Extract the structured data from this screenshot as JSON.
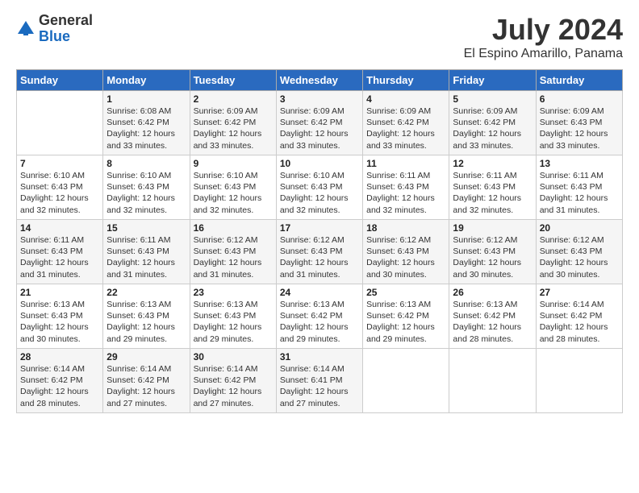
{
  "header": {
    "logo_general": "General",
    "logo_blue": "Blue",
    "month_year": "July 2024",
    "location": "El Espino Amarillo, Panama"
  },
  "days_of_week": [
    "Sunday",
    "Monday",
    "Tuesday",
    "Wednesday",
    "Thursday",
    "Friday",
    "Saturday"
  ],
  "weeks": [
    [
      {
        "day": "",
        "info": ""
      },
      {
        "day": "1",
        "info": "Sunrise: 6:08 AM\nSunset: 6:42 PM\nDaylight: 12 hours\nand 33 minutes."
      },
      {
        "day": "2",
        "info": "Sunrise: 6:09 AM\nSunset: 6:42 PM\nDaylight: 12 hours\nand 33 minutes."
      },
      {
        "day": "3",
        "info": "Sunrise: 6:09 AM\nSunset: 6:42 PM\nDaylight: 12 hours\nand 33 minutes."
      },
      {
        "day": "4",
        "info": "Sunrise: 6:09 AM\nSunset: 6:42 PM\nDaylight: 12 hours\nand 33 minutes."
      },
      {
        "day": "5",
        "info": "Sunrise: 6:09 AM\nSunset: 6:42 PM\nDaylight: 12 hours\nand 33 minutes."
      },
      {
        "day": "6",
        "info": "Sunrise: 6:09 AM\nSunset: 6:43 PM\nDaylight: 12 hours\nand 33 minutes."
      }
    ],
    [
      {
        "day": "7",
        "info": "Sunrise: 6:10 AM\nSunset: 6:43 PM\nDaylight: 12 hours\nand 32 minutes."
      },
      {
        "day": "8",
        "info": "Sunrise: 6:10 AM\nSunset: 6:43 PM\nDaylight: 12 hours\nand 32 minutes."
      },
      {
        "day": "9",
        "info": "Sunrise: 6:10 AM\nSunset: 6:43 PM\nDaylight: 12 hours\nand 32 minutes."
      },
      {
        "day": "10",
        "info": "Sunrise: 6:10 AM\nSunset: 6:43 PM\nDaylight: 12 hours\nand 32 minutes."
      },
      {
        "day": "11",
        "info": "Sunrise: 6:11 AM\nSunset: 6:43 PM\nDaylight: 12 hours\nand 32 minutes."
      },
      {
        "day": "12",
        "info": "Sunrise: 6:11 AM\nSunset: 6:43 PM\nDaylight: 12 hours\nand 32 minutes."
      },
      {
        "day": "13",
        "info": "Sunrise: 6:11 AM\nSunset: 6:43 PM\nDaylight: 12 hours\nand 31 minutes."
      }
    ],
    [
      {
        "day": "14",
        "info": "Sunrise: 6:11 AM\nSunset: 6:43 PM\nDaylight: 12 hours\nand 31 minutes."
      },
      {
        "day": "15",
        "info": "Sunrise: 6:11 AM\nSunset: 6:43 PM\nDaylight: 12 hours\nand 31 minutes."
      },
      {
        "day": "16",
        "info": "Sunrise: 6:12 AM\nSunset: 6:43 PM\nDaylight: 12 hours\nand 31 minutes."
      },
      {
        "day": "17",
        "info": "Sunrise: 6:12 AM\nSunset: 6:43 PM\nDaylight: 12 hours\nand 31 minutes."
      },
      {
        "day": "18",
        "info": "Sunrise: 6:12 AM\nSunset: 6:43 PM\nDaylight: 12 hours\nand 30 minutes."
      },
      {
        "day": "19",
        "info": "Sunrise: 6:12 AM\nSunset: 6:43 PM\nDaylight: 12 hours\nand 30 minutes."
      },
      {
        "day": "20",
        "info": "Sunrise: 6:12 AM\nSunset: 6:43 PM\nDaylight: 12 hours\nand 30 minutes."
      }
    ],
    [
      {
        "day": "21",
        "info": "Sunrise: 6:13 AM\nSunset: 6:43 PM\nDaylight: 12 hours\nand 30 minutes."
      },
      {
        "day": "22",
        "info": "Sunrise: 6:13 AM\nSunset: 6:43 PM\nDaylight: 12 hours\nand 29 minutes."
      },
      {
        "day": "23",
        "info": "Sunrise: 6:13 AM\nSunset: 6:43 PM\nDaylight: 12 hours\nand 29 minutes."
      },
      {
        "day": "24",
        "info": "Sunrise: 6:13 AM\nSunset: 6:42 PM\nDaylight: 12 hours\nand 29 minutes."
      },
      {
        "day": "25",
        "info": "Sunrise: 6:13 AM\nSunset: 6:42 PM\nDaylight: 12 hours\nand 29 minutes."
      },
      {
        "day": "26",
        "info": "Sunrise: 6:13 AM\nSunset: 6:42 PM\nDaylight: 12 hours\nand 28 minutes."
      },
      {
        "day": "27",
        "info": "Sunrise: 6:14 AM\nSunset: 6:42 PM\nDaylight: 12 hours\nand 28 minutes."
      }
    ],
    [
      {
        "day": "28",
        "info": "Sunrise: 6:14 AM\nSunset: 6:42 PM\nDaylight: 12 hours\nand 28 minutes."
      },
      {
        "day": "29",
        "info": "Sunrise: 6:14 AM\nSunset: 6:42 PM\nDaylight: 12 hours\nand 27 minutes."
      },
      {
        "day": "30",
        "info": "Sunrise: 6:14 AM\nSunset: 6:42 PM\nDaylight: 12 hours\nand 27 minutes."
      },
      {
        "day": "31",
        "info": "Sunrise: 6:14 AM\nSunset: 6:41 PM\nDaylight: 12 hours\nand 27 minutes."
      },
      {
        "day": "",
        "info": ""
      },
      {
        "day": "",
        "info": ""
      },
      {
        "day": "",
        "info": ""
      }
    ]
  ]
}
